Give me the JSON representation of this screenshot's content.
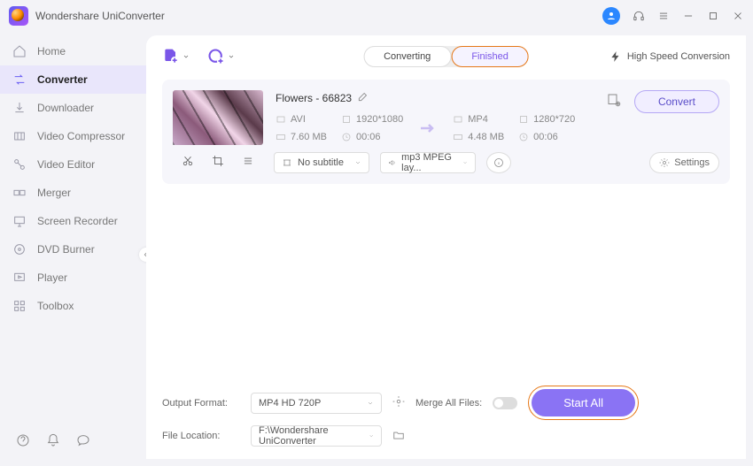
{
  "title": "Wondershare UniConverter",
  "sidebar": {
    "items": [
      {
        "label": "Home"
      },
      {
        "label": "Converter"
      },
      {
        "label": "Downloader"
      },
      {
        "label": "Video Compressor"
      },
      {
        "label": "Video Editor"
      },
      {
        "label": "Merger"
      },
      {
        "label": "Screen Recorder"
      },
      {
        "label": "DVD Burner"
      },
      {
        "label": "Player"
      },
      {
        "label": "Toolbox"
      }
    ]
  },
  "tabs": {
    "converting": "Converting",
    "finished": "Finished"
  },
  "hsc": "High Speed Conversion",
  "file": {
    "name": "Flowers - 66823",
    "src": {
      "format": "AVI",
      "resolution": "1920*1080",
      "size": "7.60 MB",
      "duration": "00:06"
    },
    "dst": {
      "format": "MP4",
      "resolution": "1280*720",
      "size": "4.48 MB",
      "duration": "00:06"
    },
    "convert": "Convert",
    "subtitle": "No subtitle",
    "audio": "mp3 MPEG lay...",
    "settings": "Settings"
  },
  "footer": {
    "outputFormatLabel": "Output Format:",
    "outputFormat": "MP4 HD 720P",
    "fileLocationLabel": "File Location:",
    "fileLocation": "F:\\Wondershare UniConverter",
    "mergeLabel": "Merge All Files:",
    "startAll": "Start All"
  }
}
